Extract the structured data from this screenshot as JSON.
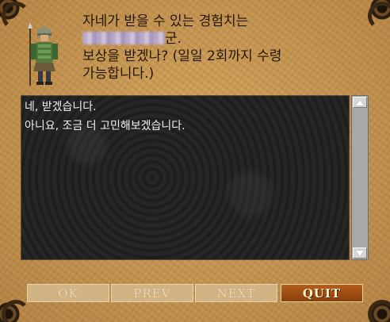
{
  "dialog": {
    "message": "자네가 받을 수 있는 경험치는\n[AMOUNT]군.\n보상을 받겠나? (일일 2회까지 수령\n가능합니다.)",
    "message_line1": "자네가 받을 수 있는 경험치는",
    "message_line2_suffix": "군.",
    "message_line3": "보상을 받겠나? (일일 2회까지 수령",
    "message_line4": "가능합니다.)",
    "npc_icon": "soldier-npc-icon"
  },
  "replies": [
    "네, 받겠습니다.",
    "아니요, 조금 더 고민해보겠습니다."
  ],
  "buttons": {
    "ok": "OK",
    "prev": "PREV",
    "next": "NEXT",
    "quit": "QUIT"
  },
  "scrollbar": {
    "up_icon": "arrow-up-icon",
    "down_icon": "arrow-down-icon"
  },
  "colors": {
    "panel": "#d4a55e",
    "reply_bg": "#1d1d1d",
    "quit_button": "#a5501a"
  }
}
